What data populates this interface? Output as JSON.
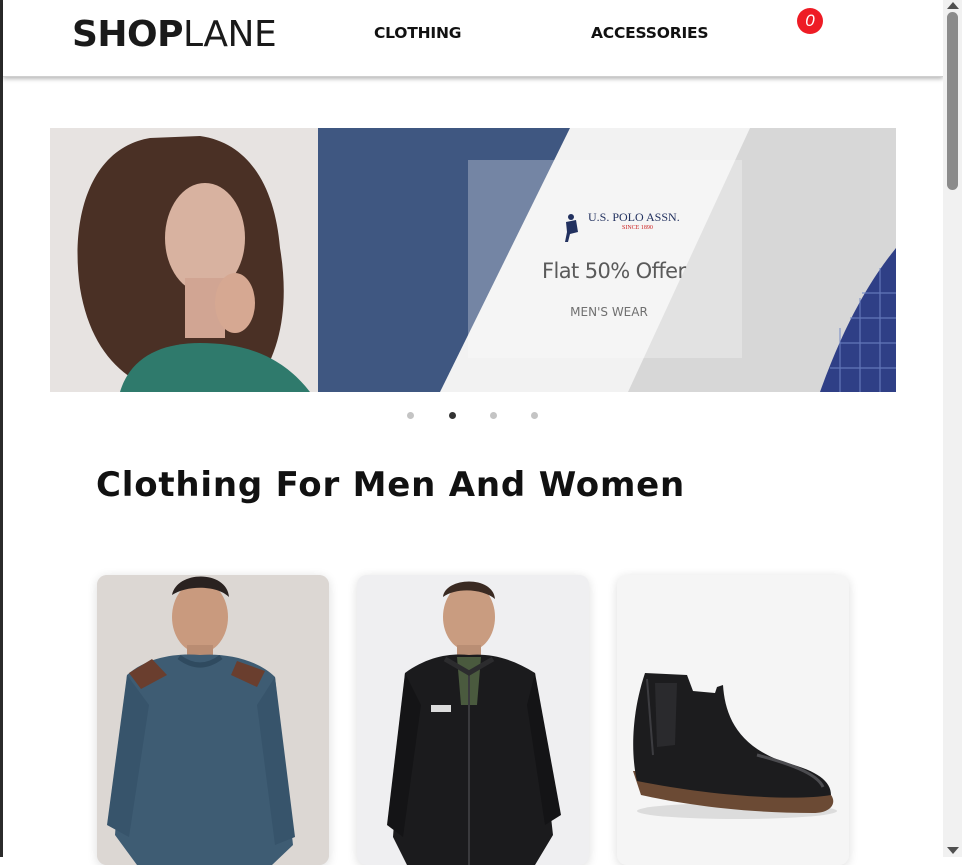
{
  "header": {
    "logo_bold": "SHOP",
    "logo_light": "LANE",
    "nav": {
      "clothing": "CLOTHING",
      "accessories": "ACCESSORIES"
    },
    "cart_count": "0"
  },
  "banner": {
    "brand": "U.S. POLO ASSN.",
    "brand_since": "SINCE 1890",
    "offer": "Flat 50% Offer",
    "subtitle": "MEN'S WEAR",
    "active_slide": 2,
    "slide_count": 4
  },
  "section": {
    "title": "Clothing For Men And Women"
  },
  "colors": {
    "cart_badge": "#ee1c25",
    "banner_navy": "#3f5781",
    "active_dot": "#333333"
  }
}
